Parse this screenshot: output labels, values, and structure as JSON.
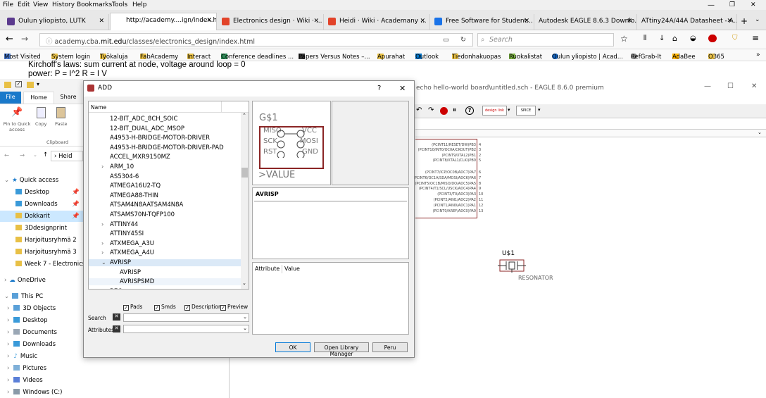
{
  "menu": [
    "File",
    "Edit",
    "View",
    "History",
    "Bookmarks",
    "Tools",
    "Help"
  ],
  "tabs": [
    {
      "label": "Oulun yliopisto, LUTK",
      "color": "#5b3a8e"
    },
    {
      "label": "http://academy....ign/index.html",
      "color": "#ffffff"
    },
    {
      "label": "Electronics design · Wiki · ...",
      "color": "#e24329"
    },
    {
      "label": "Heidi · Wiki · Academany ...",
      "color": "#e24329"
    },
    {
      "label": "Free Software for Student...",
      "color": "#1a73e8"
    },
    {
      "label": "Autodesk EAGLE 8.6.3 Downlo...",
      "color": "#777777"
    },
    {
      "label": "ATtiny24A/44A Datasheet - A...",
      "color": "#777777"
    }
  ],
  "nav": {
    "url_host": "academy.cba.",
    "url_domain": "mit.edu",
    "url_path": "/classes/electronics_design/index.html",
    "search_placeholder": "Search"
  },
  "bookmarks": [
    "Most Visited",
    "System login",
    "Työkaluja",
    "FabAcademy",
    "Interact",
    "Conference deadlines ...",
    "Papers Versus Notes –...",
    "Apurahat",
    "Outlook",
    "Tiedonhakuopas",
    "Ruokalistat",
    "Oulun yliopisto | Acad...",
    "RefGrab-It",
    "AdaBee",
    "O365"
  ],
  "page": {
    "line1": "Kirchoff's laws: sum current at node, voltage around loop = 0",
    "line2": "power: P = I^2 R = I V"
  },
  "explorer": {
    "ribbon": {
      "file": "File",
      "home": "Home",
      "share": "Share",
      "pin": "Pin to Quick access",
      "copy": "Copy",
      "paste": "Paste",
      "clipboard": "Clipboard"
    },
    "path": "Heid",
    "quick_access": "Quick access",
    "quick_items": [
      "Desktop",
      "Downloads",
      "Dokkarit",
      "3Ddesignprint",
      "Harjoitusryhmä 2",
      "Harjoitusryhmä 3",
      "Week 7 - Electronics"
    ],
    "onedrive": "OneDrive",
    "thispc": "This PC",
    "pc_items": [
      "3D Objects",
      "Desktop",
      "Documents",
      "Downloads",
      "Music",
      "Pictures",
      "Videos",
      "Windows (C:)"
    ]
  },
  "eagle": {
    "title": "echo hello-world board\\untitled.sch - EAGLE 8.6.0 premium",
    "pins": [
      "(PCINT11/RESET/DW)PB3",
      "(PCINT10/INT0/OC0A/CKOUT)PB2",
      "(PCINT9/XTAL2)PB1",
      "(PCINT8/XTAL1/CLKI)PB0",
      "(PCINT7/ICP/OC0B/ADC7)PA7",
      "(PCINT6/OC1A/SDA/MOSI/ADC6)PA6",
      "(PCINT5/OC1B/MISO/DO/ADC5)PA5",
      "(PCINT4/T1/SCL/USCK/ADC4)PA4",
      "(PCINT3/T0/ADC3)PA3",
      "(PCINT2/AIN1/ADC2)PA2",
      "(PCINT1/AIN0/ADC1)PA1",
      "(PCINT0/AREF/ADC0)PA0"
    ],
    "pin_numbers": [
      "4",
      "3",
      "2",
      "5",
      "6",
      "7",
      "8",
      "9",
      "10",
      "11",
      "12",
      "13"
    ],
    "resonator_ref": "U$1",
    "resonator_label": "RESONATOR"
  },
  "dialog": {
    "title": "ADD",
    "help": "?",
    "close": "✕",
    "col_name": "Name",
    "tree": [
      {
        "label": "12-BIT_ADC_8CH_SOIC",
        "level": 0,
        "exp": ""
      },
      {
        "label": "12-BIT_DUAL_ADC_MSOP",
        "level": 0,
        "exp": ""
      },
      {
        "label": "A4953-H-BRIDGE-MOTOR-DRIVER",
        "level": 0,
        "exp": ""
      },
      {
        "label": "A4953-H-BRIDGE-MOTOR-DRIVER-PAD",
        "level": 0,
        "exp": ""
      },
      {
        "label": "ACCEL_MXR9150MZ",
        "level": 0,
        "exp": ""
      },
      {
        "label": "ARM_10",
        "level": 0,
        "exp": ">"
      },
      {
        "label": "AS5304-6",
        "level": 0,
        "exp": ""
      },
      {
        "label": "ATMEGA16U2-TQ",
        "level": 0,
        "exp": ""
      },
      {
        "label": "ATMEGA88-THIN",
        "level": 0,
        "exp": ""
      },
      {
        "label": "ATSAM4N8AATSAM4N8A",
        "level": 0,
        "exp": ""
      },
      {
        "label": "ATSAMS70N-TQFP100",
        "level": 0,
        "exp": ""
      },
      {
        "label": "ATTINY44",
        "level": 0,
        "exp": ">"
      },
      {
        "label": "ATTINY45SI",
        "level": 0,
        "exp": ""
      },
      {
        "label": "ATXMEGA_A3U",
        "level": 0,
        "exp": ">"
      },
      {
        "label": "ATXMEGA_A4U",
        "level": 0,
        "exp": ">"
      },
      {
        "label": "AVRISP",
        "level": 0,
        "exp": "v"
      },
      {
        "label": "AVRISP",
        "level": 1,
        "exp": ""
      },
      {
        "label": "AVRISPSMD",
        "level": 1,
        "exp": ""
      },
      {
        "label": "BEC",
        "level": 0,
        "exp": ""
      }
    ],
    "symbol": {
      "name": "G$1",
      "pins_left": [
        "MISO",
        "SCK",
        "RST"
      ],
      "pins_right": [
        "VCC",
        "MOSI",
        "GND"
      ],
      "value": ">VALUE"
    },
    "desc_title": "AVRISP",
    "attr_col": "Attribute",
    "value_col": "Value",
    "checks": [
      {
        "label": "Pads",
        "checked": true
      },
      {
        "label": "Smds",
        "checked": true
      },
      {
        "label": "Description",
        "checked": true
      },
      {
        "label": "Preview",
        "checked": true
      }
    ],
    "search_label": "Search",
    "attributes_label": "Attributes",
    "ok": "OK",
    "open_lib": "Open Library Manager",
    "cancel": "Peru"
  }
}
